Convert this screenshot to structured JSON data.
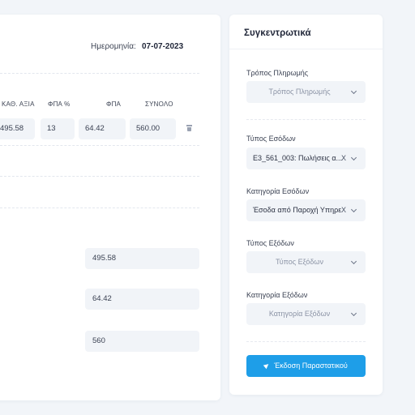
{
  "header": {
    "date_label": "Ημερομηνία:",
    "date_value": "07-07-2023"
  },
  "table": {
    "columns": [
      "ΚΑΘ. ΑΞΙΑ",
      "ΦΠΑ %",
      "ΦΠΑ",
      "ΣΥΝΟΛΟ"
    ],
    "row": {
      "net_value": "495.58",
      "vat_percent": "13",
      "vat": "64.42",
      "total": "560.00"
    }
  },
  "totals": {
    "net": "495.58",
    "vat": "64.42",
    "grand_total": "560"
  },
  "summary": {
    "title": "Συγκεντρωτικά",
    "payment_method": {
      "label": "Τρόπος Πληρωμής",
      "placeholder": "Τρόπος Πληρωμής",
      "value": ""
    },
    "income_type": {
      "label": "Τύπος Εσόδων",
      "value": "E3_561_003: Πωλήσεις α..."
    },
    "income_category": {
      "label": "Κατηγορία Εσόδων",
      "value": "Έσοδα από Παροχή Υπηρε"
    },
    "expense_type": {
      "label": "Τύπος Εξόδων",
      "placeholder": "Τύπος Εξόδων",
      "value": ""
    },
    "expense_category": {
      "label": "Κατηγορία Εξόδων",
      "placeholder": "Κατηγορία Εξόδων",
      "value": ""
    },
    "clear_glyph": "X",
    "issue_button": "Έκδοση Παραστατικού"
  },
  "colors": {
    "accent": "#1e9ee8",
    "background": "#f2f5f9",
    "field_bg": "#f1f4f8"
  },
  "icons": [
    "chevron-down-icon",
    "trash-icon",
    "send-icon"
  ]
}
